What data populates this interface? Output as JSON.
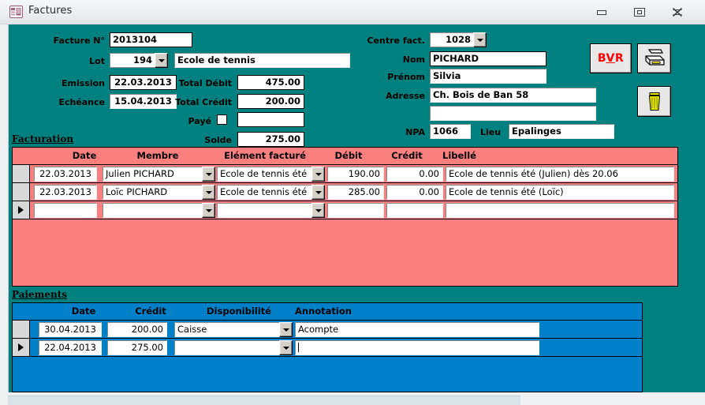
{
  "window": {
    "title": "Factures",
    "icon": "access-form-icon",
    "controls": {
      "minimize": "minimize-icon",
      "restore": "restore-icon",
      "close": "close-icon"
    }
  },
  "colors": {
    "form_background": "#00807E",
    "facturation_sheet": "#FA7F7F",
    "paiements_sheet": "#0080C8",
    "bvr_text": "#FF0000",
    "titlebar": "#ECEEF0"
  },
  "header": {
    "facture_no": {
      "label": "Facture N°",
      "value": "2013104"
    },
    "lot": {
      "label": "Lot",
      "value": "194",
      "description": "Ecole de tennis"
    },
    "emission": {
      "label": "Emission",
      "value": "22.03.2013"
    },
    "echeance": {
      "label": "Echéance",
      "value": "15.04.2013"
    },
    "total_debit": {
      "label": "Total Débit",
      "value": "475.00"
    },
    "total_credit": {
      "label": "Total Crédit",
      "value": "200.00"
    },
    "paye": {
      "label": "Payé",
      "checked": false,
      "value": ""
    },
    "solde": {
      "label": "Solde",
      "value": "275.00"
    },
    "centre_fact": {
      "label": "Centre fact.",
      "value": "1028"
    },
    "nom": {
      "label": "Nom",
      "value": "PICHARD"
    },
    "prenom": {
      "label": "Prénom",
      "value": "Silvia"
    },
    "adresse": {
      "label": "Adresse",
      "value": "Ch. Bois de Ban 58",
      "value2": ""
    },
    "npa": {
      "label": "NPA",
      "value": "1066"
    },
    "lieu": {
      "label": "Lieu",
      "value": "Epalinges"
    }
  },
  "actions": {
    "bvr": {
      "label": "BVR",
      "underlined_char": "V"
    },
    "print": {
      "icon": "printer-icon"
    },
    "delete": {
      "icon": "trash-icon"
    }
  },
  "facturation": {
    "caption": "Facturation",
    "columns": [
      "Date",
      "Membre",
      "Elément facturé",
      "Débit",
      "Crédit",
      "Libellé"
    ],
    "rows": [
      {
        "date": "22.03.2013",
        "membre": "Julien PICHARD",
        "element": "Ecole de tennis été",
        "debit": "190.00",
        "credit": "0.00",
        "libelle": "Ecole de tennis été (Julien) dès 20.06",
        "current": false
      },
      {
        "date": "22.03.2013",
        "membre": "Loïc PICHARD",
        "element": "Ecole de tennis été",
        "debit": "285.00",
        "credit": "0.00",
        "libelle": "Ecole de tennis été (Loïc)",
        "current": false
      },
      {
        "date": "",
        "membre": "",
        "element": "",
        "debit": "",
        "credit": "",
        "libelle": "",
        "current": true
      }
    ]
  },
  "paiements": {
    "caption": "Paiements",
    "columns": [
      "Date",
      "Crédit",
      "Disponibilité",
      "Annotation"
    ],
    "rows": [
      {
        "date": "30.04.2013",
        "credit": "200.00",
        "disponibilite": "Caisse",
        "annotation": "Acompte",
        "current": false
      },
      {
        "date": "22.04.2013",
        "credit": "275.00",
        "disponibilite": "",
        "annotation": "",
        "current": true
      }
    ]
  }
}
